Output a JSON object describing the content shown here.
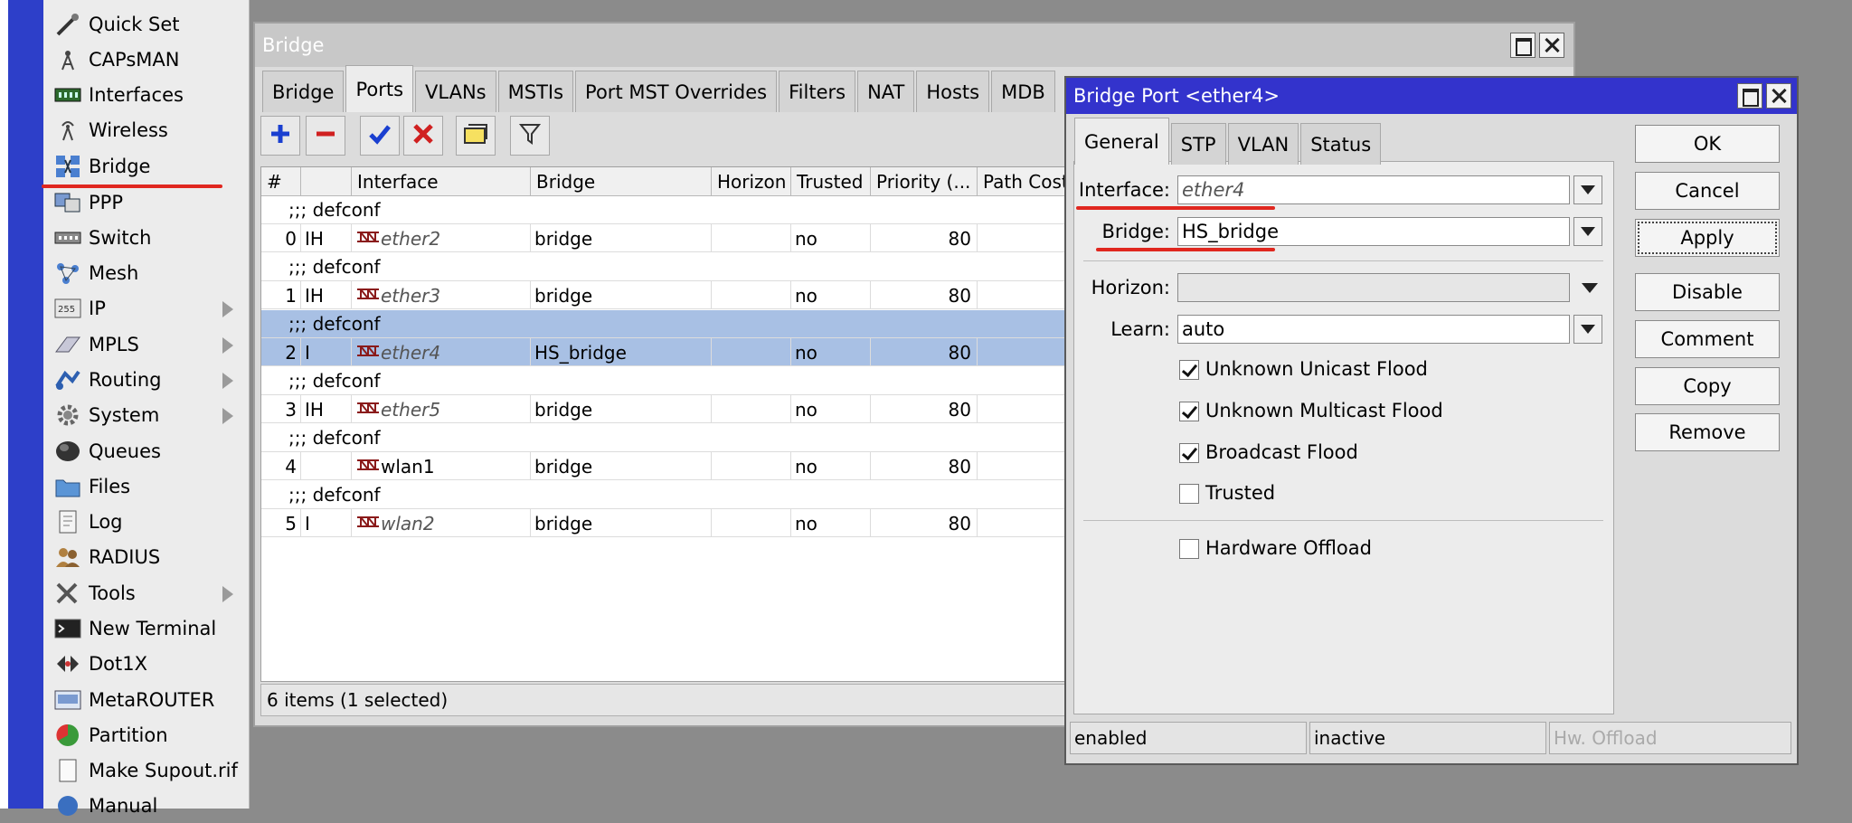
{
  "sidebar": {
    "items": [
      {
        "label": "Quick Set",
        "icon": "wand-icon"
      },
      {
        "label": "CAPsMAN",
        "icon": "antenna-icon"
      },
      {
        "label": "Interfaces",
        "icon": "interfaces-icon"
      },
      {
        "label": "Wireless",
        "icon": "wireless-icon"
      },
      {
        "label": "Bridge",
        "icon": "bridge-icon"
      },
      {
        "label": "PPP",
        "icon": "ppp-icon"
      },
      {
        "label": "Switch",
        "icon": "switch-icon"
      },
      {
        "label": "Mesh",
        "icon": "mesh-icon"
      },
      {
        "label": "IP",
        "icon": "ip-icon"
      },
      {
        "label": "MPLS",
        "icon": "mpls-icon"
      },
      {
        "label": "Routing",
        "icon": "routing-icon"
      },
      {
        "label": "System",
        "icon": "gear-icon"
      },
      {
        "label": "Queues",
        "icon": "queues-icon"
      },
      {
        "label": "Files",
        "icon": "folder-icon"
      },
      {
        "label": "Log",
        "icon": "log-icon"
      },
      {
        "label": "RADIUS",
        "icon": "users-icon"
      },
      {
        "label": "Tools",
        "icon": "tools-icon"
      },
      {
        "label": "New Terminal",
        "icon": "terminal-icon"
      },
      {
        "label": "Dot1X",
        "icon": "dot1x-icon"
      },
      {
        "label": "MetaROUTER",
        "icon": "metarouter-icon"
      },
      {
        "label": "Partition",
        "icon": "partition-icon"
      },
      {
        "label": "Make Supout.rif",
        "icon": "document-icon"
      },
      {
        "label": "Manual",
        "icon": "help-icon"
      }
    ]
  },
  "bridge_window": {
    "title": "Bridge",
    "tabs": [
      "Bridge",
      "Ports",
      "VLANs",
      "MSTIs",
      "Port MST Overrides",
      "Filters",
      "NAT",
      "Hosts",
      "MDB"
    ],
    "active_tab": "Ports",
    "columns": [
      "#",
      "",
      "Interface",
      "Bridge",
      "Horizon",
      "Trusted",
      "Priority (...",
      "Path Cost"
    ],
    "comment": ";;; defconf",
    "rows": [
      {
        "num": "0",
        "flags": "IH",
        "interface": "ether2",
        "bridge": "bridge",
        "horizon": "",
        "trusted": "no",
        "priority": "80"
      },
      {
        "num": "1",
        "flags": "IH",
        "interface": "ether3",
        "bridge": "bridge",
        "horizon": "",
        "trusted": "no",
        "priority": "80"
      },
      {
        "num": "2",
        "flags": "I",
        "interface": "ether4",
        "bridge": "HS_bridge",
        "horizon": "",
        "trusted": "no",
        "priority": "80"
      },
      {
        "num": "3",
        "flags": "IH",
        "interface": "ether5",
        "bridge": "bridge",
        "horizon": "",
        "trusted": "no",
        "priority": "80"
      },
      {
        "num": "4",
        "flags": "",
        "interface": "wlan1",
        "bridge": "bridge",
        "horizon": "",
        "trusted": "no",
        "priority": "80"
      },
      {
        "num": "5",
        "flags": "I",
        "interface": "wlan2",
        "bridge": "bridge",
        "horizon": "",
        "trusted": "no",
        "priority": "80"
      }
    ],
    "status": "6 items (1 selected)"
  },
  "dialog": {
    "title": "Bridge Port <ether4>",
    "tabs": [
      "General",
      "STP",
      "VLAN",
      "Status"
    ],
    "active_tab": "General",
    "fields": {
      "interface_label": "Interface:",
      "interface_value": "ether4",
      "bridge_label": "Bridge:",
      "bridge_value": "HS_bridge",
      "horizon_label": "Horizon:",
      "horizon_value": "",
      "learn_label": "Learn:",
      "learn_value": "auto"
    },
    "checkboxes": [
      {
        "label": "Unknown Unicast Flood",
        "checked": true
      },
      {
        "label": "Unknown Multicast Flood",
        "checked": true
      },
      {
        "label": "Broadcast Flood",
        "checked": true
      },
      {
        "label": "Trusted",
        "checked": false
      },
      {
        "label": "Hardware Offload",
        "checked": false
      }
    ],
    "buttons": [
      "OK",
      "Cancel",
      "Apply",
      "Disable",
      "Comment",
      "Copy",
      "Remove"
    ],
    "status": {
      "state": "enabled",
      "link": "inactive",
      "hw": "Hw. Offload"
    }
  },
  "colors": {
    "accent": "#3333cc",
    "selection": "#a8c0e4",
    "annotation": "#e0271f"
  }
}
